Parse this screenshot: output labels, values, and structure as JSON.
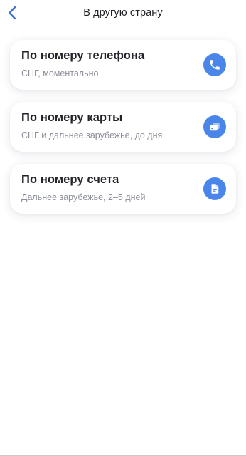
{
  "header": {
    "title": "В другую страну"
  },
  "options": [
    {
      "title": "По номеру телефона",
      "subtitle": "СНГ, моментально",
      "icon": "phone-icon"
    },
    {
      "title": "По номеру карты",
      "subtitle": "СНГ и дальнее зарубежье, до дня",
      "icon": "card-icon"
    },
    {
      "title": "По номеру счета",
      "subtitle": "Дальнее зарубежье, 2–5 дней",
      "icon": "document-icon"
    }
  ],
  "colors": {
    "accent": "#4a86ea",
    "title_text": "#1f1f24",
    "subtitle_text": "#8c8f99"
  }
}
